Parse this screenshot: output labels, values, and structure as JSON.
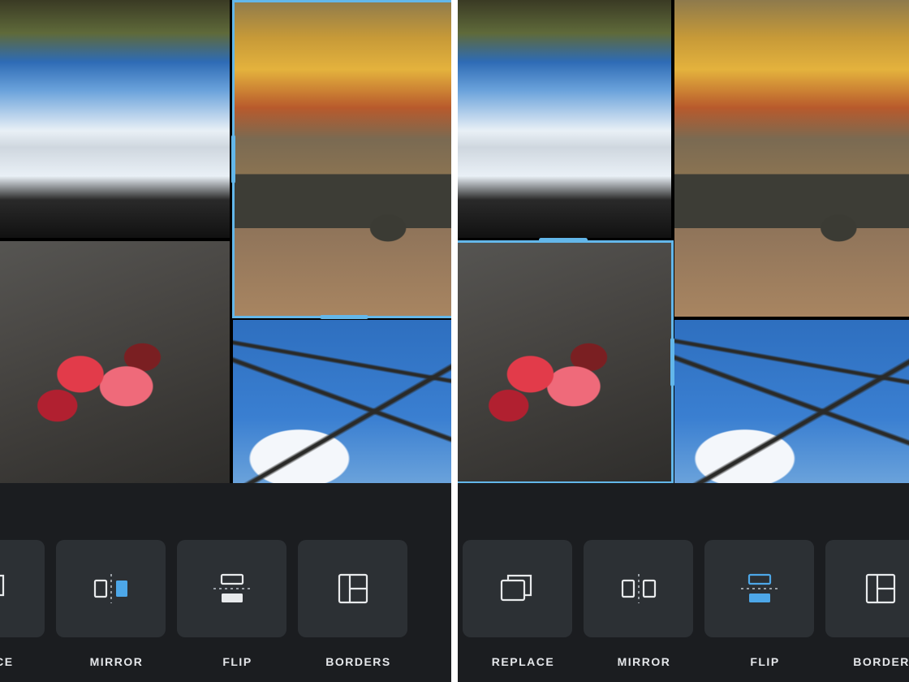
{
  "accent": "#4DA7E8",
  "selection_border": "#63B7EA",
  "panels": {
    "left": {
      "selected_cell": "bench",
      "active_tool": "mirror",
      "toolbar": [
        {
          "id": "replace",
          "label": "REPLACE",
          "visible_label": "LACE"
        },
        {
          "id": "mirror",
          "label": "MIRROR"
        },
        {
          "id": "flip",
          "label": "FLIP"
        },
        {
          "id": "borders",
          "label": "BORDERS"
        }
      ]
    },
    "right": {
      "selected_cell": "leaves",
      "active_tool": "flip",
      "toolbar": [
        {
          "id": "replace",
          "label": "REPLACE"
        },
        {
          "id": "mirror",
          "label": "MIRROR"
        },
        {
          "id": "flip",
          "label": "FLIP"
        },
        {
          "id": "borders",
          "label": "BORDERS"
        }
      ]
    }
  },
  "cells": {
    "sky": "autumn-sky-trees",
    "bench": "park-bench-fall",
    "leaves": "red-leaves-ground",
    "branches": "bare-branches-blue-sky"
  }
}
